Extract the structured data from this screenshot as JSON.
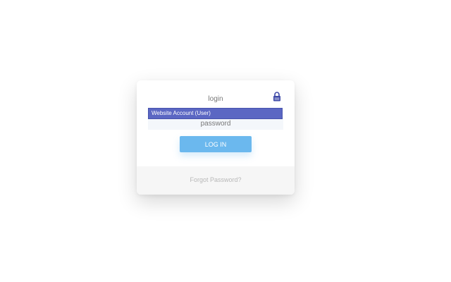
{
  "login_form": {
    "login_placeholder": "login",
    "password_placeholder": "password",
    "login_button_label": "LOG IN",
    "forgot_password_label": "Forgot Password?"
  },
  "autofill": {
    "items": [
      {
        "label": "Website Account (User)"
      }
    ]
  },
  "icons": {
    "lock": "lock-icon"
  },
  "colors": {
    "button": "#6bb8ee",
    "autofill_highlight": "#5b67c3",
    "lock_icon": "#3f4aa8",
    "footer_background": "#f6f6f6"
  }
}
